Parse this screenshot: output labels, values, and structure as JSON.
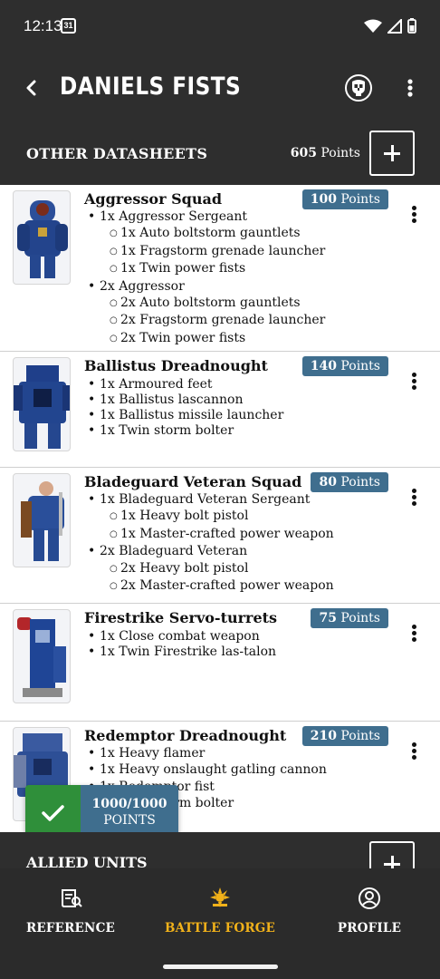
{
  "status": {
    "time": "12:13",
    "calendar_day": "31"
  },
  "header": {
    "title": "DANIELS FISTS"
  },
  "section": {
    "title": "OTHER DATASHEETS",
    "points_value": "605",
    "points_label": "Points"
  },
  "units": [
    {
      "name": "Aggressor Squad",
      "points": "100",
      "points_label": "Points",
      "wargear": [
        {
          "level": 1,
          "text": "1x Aggressor Sergeant"
        },
        {
          "level": 2,
          "text": "1x Auto boltstorm gauntlets"
        },
        {
          "level": 2,
          "text": "1x Fragstorm grenade launcher"
        },
        {
          "level": 2,
          "text": "1x Twin power fists"
        },
        {
          "level": 1,
          "text": "2x Aggressor"
        },
        {
          "level": 2,
          "text": "2x Auto boltstorm gauntlets"
        },
        {
          "level": 2,
          "text": "2x Fragstorm grenade launcher"
        },
        {
          "level": 2,
          "text": "2x Twin power fists"
        }
      ]
    },
    {
      "name": "Ballistus Dreadnought",
      "points": "140",
      "points_label": "Points",
      "wargear": [
        {
          "level": 1,
          "text": "1x Armoured feet"
        },
        {
          "level": 1,
          "text": "1x Ballistus lascannon"
        },
        {
          "level": 1,
          "text": "1x Ballistus missile launcher"
        },
        {
          "level": 1,
          "text": "1x Twin storm bolter"
        }
      ]
    },
    {
      "name": "Bladeguard Veteran Squad",
      "points": "80",
      "points_label": "Points",
      "wargear": [
        {
          "level": 1,
          "text": "1x Bladeguard Veteran Sergeant"
        },
        {
          "level": 2,
          "text": "1x Heavy bolt pistol"
        },
        {
          "level": 2,
          "text": "1x Master-crafted power weapon"
        },
        {
          "level": 1,
          "text": "2x Bladeguard Veteran"
        },
        {
          "level": 2,
          "text": "2x Heavy bolt pistol"
        },
        {
          "level": 2,
          "text": "2x Master-crafted power weapon"
        }
      ]
    },
    {
      "name": "Firestrike Servo-turrets",
      "points": "75",
      "points_label": "Points",
      "wargear": [
        {
          "level": 1,
          "text": "1x Close combat weapon"
        },
        {
          "level": 1,
          "text": "1x Twin Firestrike las-talon"
        }
      ]
    },
    {
      "name": "Redemptor Dreadnought",
      "points": "210",
      "points_label": "Points",
      "wargear": [
        {
          "level": 1,
          "text": "1x Heavy flamer"
        },
        {
          "level": 1,
          "text": "1x Heavy onslaught gatling cannon"
        },
        {
          "level": 1,
          "text": "1x Redemptor fist"
        },
        {
          "level": 1,
          "text": "1x Twin storm bolter"
        }
      ]
    }
  ],
  "toast": {
    "value": "1000/1000",
    "label": "POINTS"
  },
  "allied": {
    "title": "ALLIED UNITS"
  },
  "nav": [
    {
      "label": "REFERENCE",
      "icon": "reference-scroll-icon"
    },
    {
      "label": "BATTLE FORGE",
      "icon": "battle-forge-icon",
      "active": true
    },
    {
      "label": "PROFILE",
      "icon": "profile-icon"
    }
  ],
  "colors": {
    "bar": "#2e2e2e",
    "points_badge": "#3f6e8e",
    "success": "#2f8f3a",
    "active_nav": "#f2b21a"
  }
}
